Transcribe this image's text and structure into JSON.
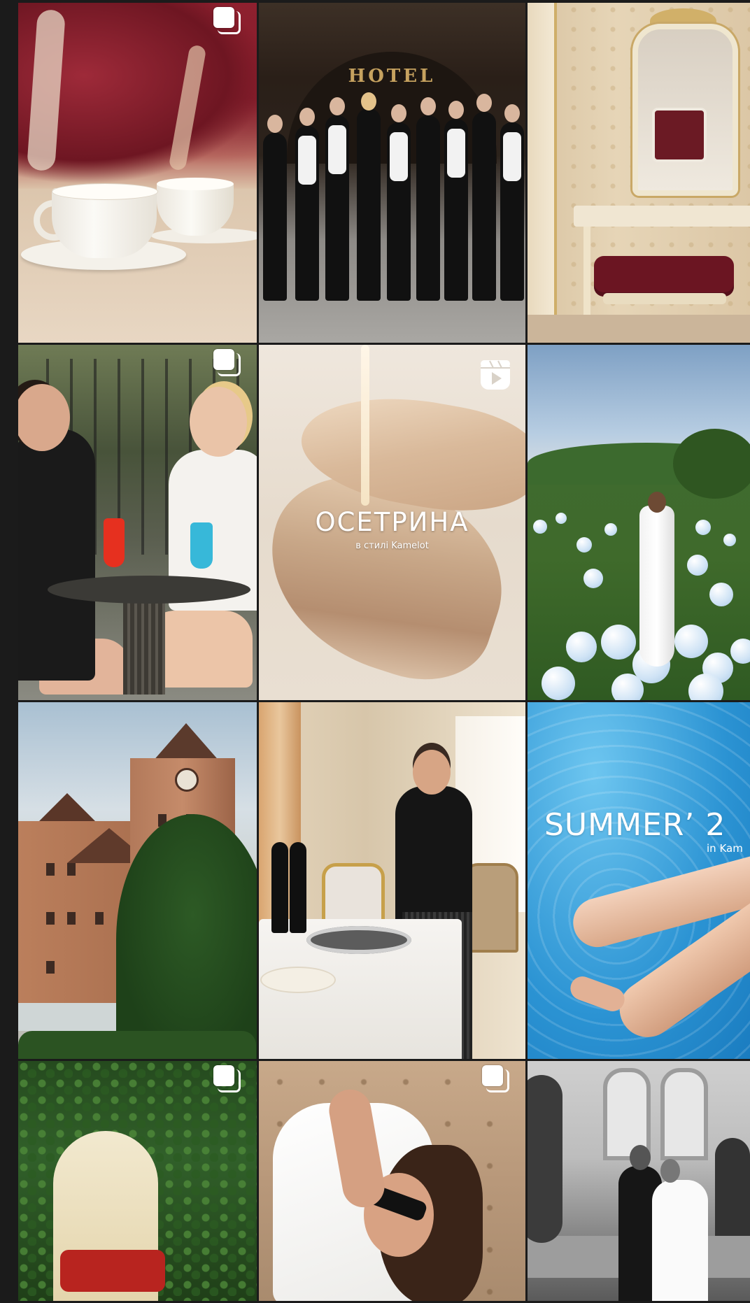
{
  "grid": {
    "tiles": [
      {
        "id": "coffee-cups",
        "badge": "multi-photo-icon"
      },
      {
        "id": "hotel-staff",
        "badge": "none",
        "sign_text": "HOTEL"
      },
      {
        "id": "vanity-mirror",
        "badge": "none"
      },
      {
        "id": "women-drinks",
        "badge": "multi-photo-icon"
      },
      {
        "id": "sturgeon-dish",
        "badge": "reel-icon",
        "overlay_title": "ОСЕТРИНА",
        "overlay_subtitle": "в стилі Kamelot"
      },
      {
        "id": "bride-balloons",
        "badge": "none"
      },
      {
        "id": "castle-hotel",
        "badge": "none"
      },
      {
        "id": "chef-table",
        "badge": "none"
      },
      {
        "id": "summer-pool",
        "badge": "none",
        "overlay_title": "SUMMER’ 2",
        "overlay_subtitle": "in Kam"
      },
      {
        "id": "garden-arch",
        "badge": "multi-photo-icon"
      },
      {
        "id": "woman-robe",
        "badge": "multi-photo-icon"
      },
      {
        "id": "wedding-couple",
        "badge": "none"
      }
    ]
  },
  "colors": {
    "background": "#1b1b1b",
    "badge": "#ffffff"
  }
}
